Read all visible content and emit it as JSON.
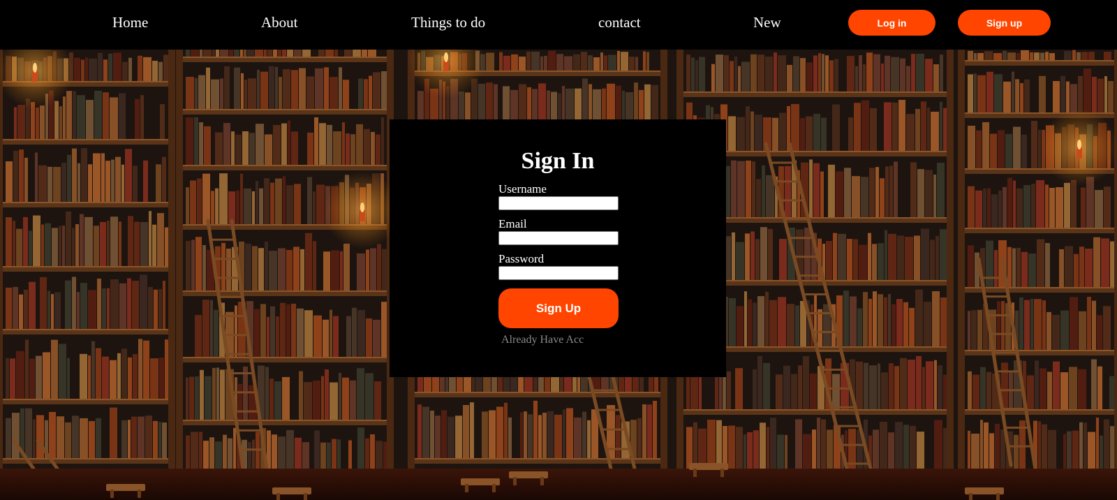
{
  "nav": {
    "links": [
      "Home",
      "About",
      "Things to do",
      "contact",
      "New"
    ],
    "login_label": "Log in",
    "signup_label": "Sign up"
  },
  "form": {
    "title": "Sign In",
    "username_label": "Username",
    "username_value": "",
    "email_label": "Email",
    "email_value": "",
    "password_label": "Password",
    "password_value": "",
    "submit_label": "Sign Up",
    "already_link": "Already Have Acc"
  },
  "colors": {
    "accent": "#ff4500",
    "nav_background": "#000000",
    "card_background": "#000000",
    "text": "#ffffff",
    "muted_link": "#8a8a8a"
  },
  "background": {
    "description_icon": "bookshelf-library-illustration"
  }
}
